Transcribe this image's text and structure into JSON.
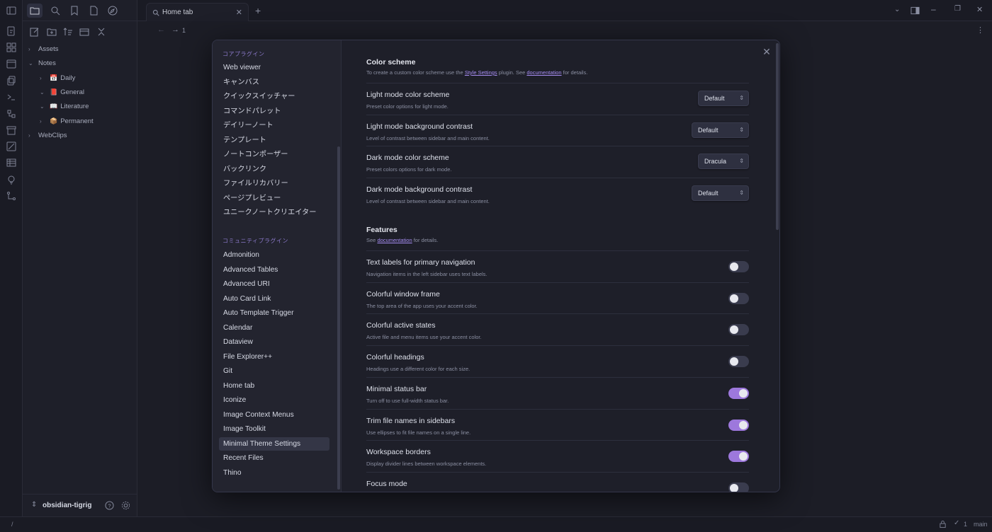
{
  "tab": {
    "title": "Home tab"
  },
  "nav": {
    "back_label": "1"
  },
  "file_tree": [
    {
      "label": "Assets",
      "level": 0,
      "chevron": "›",
      "icon": ""
    },
    {
      "label": "Notes",
      "level": 0,
      "chevron": "⌄",
      "icon": ""
    },
    {
      "label": "Daily",
      "level": 1,
      "chevron": "›",
      "icon": "📅"
    },
    {
      "label": "General",
      "level": 1,
      "chevron": "⌄",
      "icon": "📕"
    },
    {
      "label": "Literature",
      "level": 1,
      "chevron": "⌄",
      "icon": "📖"
    },
    {
      "label": "Permanent",
      "level": 1,
      "chevron": "›",
      "icon": "📦"
    },
    {
      "label": "WebClips",
      "level": 0,
      "chevron": "›",
      "icon": ""
    }
  ],
  "vault": {
    "name": "obsidian-tigrig"
  },
  "status": {
    "path": "/",
    "count": "1",
    "branch": "main"
  },
  "settings_sidebar": {
    "core_header": "コアプラグイン",
    "core_plugins": [
      "Web viewer",
      "キャンバス",
      "クイックスイッチャー",
      "コマンドパレット",
      "デイリーノート",
      "テンプレート",
      "ノートコンポーザー",
      "バックリンク",
      "ファイルリカバリー",
      "ページプレビュー",
      "ユニークノートクリエイター"
    ],
    "community_header": "コミュニティプラグイン",
    "community_plugins": [
      "Admonition",
      "Advanced Tables",
      "Advanced URI",
      "Auto Card Link",
      "Auto Template Trigger",
      "Calendar",
      "Dataview",
      "File Explorer++",
      "Git",
      "Home tab",
      "Iconize",
      "Image Context Menus",
      "Image Toolkit",
      "Minimal Theme Settings",
      "Recent Files",
      "Thino"
    ],
    "selected": "Minimal Theme Settings"
  },
  "color_scheme": {
    "title": "Color scheme",
    "desc_pre": "To create a custom color scheme use the ",
    "desc_link1": "Style Settings",
    "desc_mid": " plugin. See ",
    "desc_link2": "documentation",
    "desc_post": " for details.",
    "settings": [
      {
        "name": "Light mode color scheme",
        "desc": "Preset color options for light mode.",
        "value": "Default"
      },
      {
        "name": "Light mode background contrast",
        "desc": "Level of contrast between sidebar and main content.",
        "value": "Default"
      },
      {
        "name": "Dark mode color scheme",
        "desc": "Preset colors options for dark mode.",
        "value": "Dracula"
      },
      {
        "name": "Dark mode background contrast",
        "desc": "Level of contrast between sidebar and main content.",
        "value": "Default"
      }
    ]
  },
  "features": {
    "title": "Features",
    "desc_pre": "See ",
    "desc_link": "documentation",
    "desc_post": " for details.",
    "settings": [
      {
        "name": "Text labels for primary navigation",
        "desc": "Navigation items in the left sidebar uses text labels.",
        "on": false
      },
      {
        "name": "Colorful window frame",
        "desc": "The top area of the app uses your accent color.",
        "on": false
      },
      {
        "name": "Colorful active states",
        "desc": "Active file and menu items use your accent color.",
        "on": false
      },
      {
        "name": "Colorful headings",
        "desc": "Headings use a different color for each size.",
        "on": false
      },
      {
        "name": "Minimal status bar",
        "desc": "Turn off to use full-width status bar.",
        "on": true
      },
      {
        "name": "Trim file names in sidebars",
        "desc": "Use ellipses to fit file names on a single line.",
        "on": true
      },
      {
        "name": "Workspace borders",
        "desc": "Display divider lines between workspace elements.",
        "on": true
      },
      {
        "name": "Focus mode",
        "desc": "",
        "on": false
      }
    ]
  },
  "colors": {
    "accent": "#9d78dc",
    "bg": "#1e1f29",
    "sidebar": "#23242f"
  }
}
